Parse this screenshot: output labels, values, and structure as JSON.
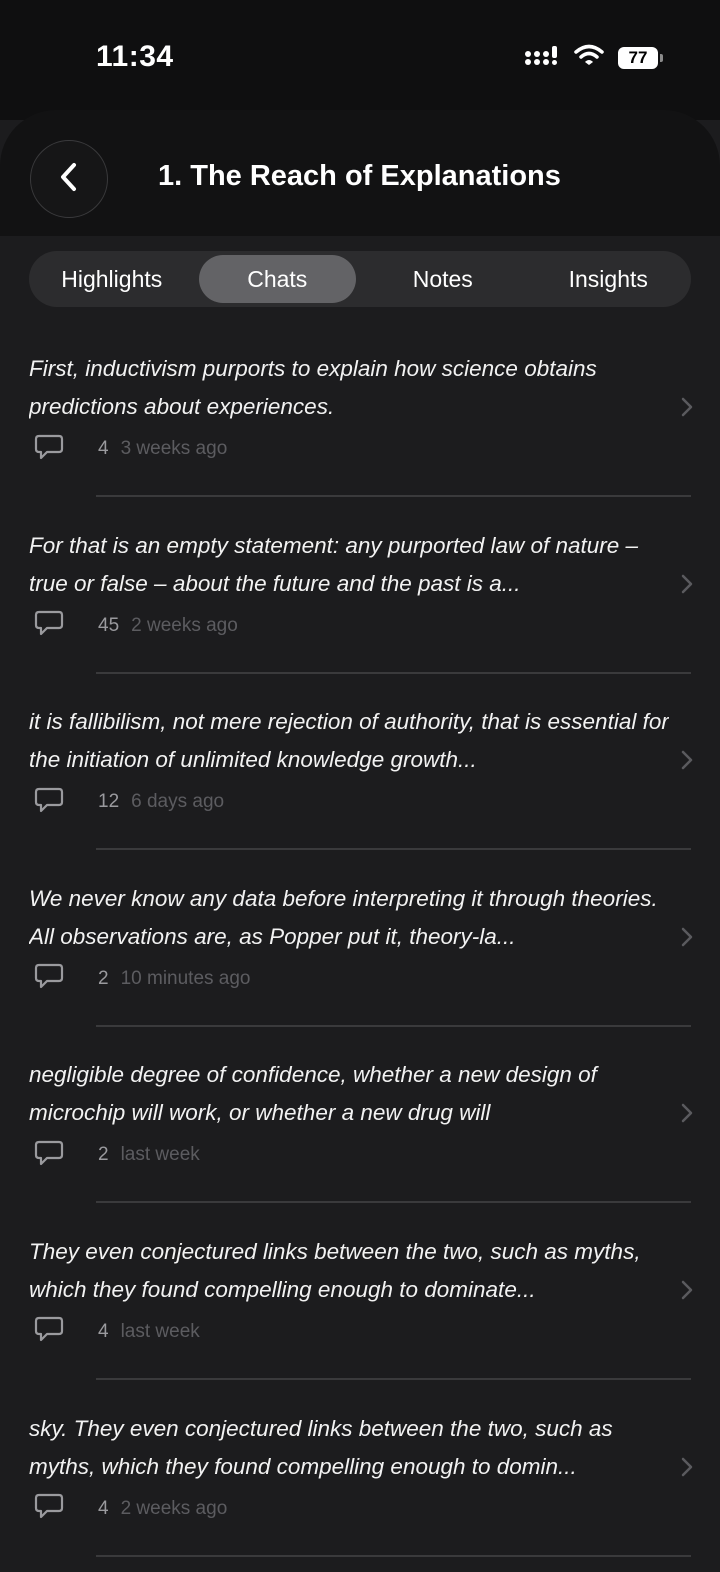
{
  "status_bar": {
    "time": "11:34",
    "battery": "77",
    "icons": [
      "signal-icon",
      "wifi-icon",
      "battery-icon"
    ]
  },
  "header": {
    "title": "1. The Reach of Explanations",
    "back_icon": "chevron-left-icon"
  },
  "tabs": [
    {
      "label": "Highlights",
      "active": false
    },
    {
      "label": "Chats",
      "active": true
    },
    {
      "label": "Notes",
      "active": false
    },
    {
      "label": "Insights",
      "active": false
    }
  ],
  "chats": [
    {
      "quote": "First, inductivism purports to explain how science obtains predictions about experiences.",
      "count": "4",
      "time": "3 weeks ago"
    },
    {
      "quote": "For that is an empty statement: any purported law of nature – true or false – about the future and the past is a...",
      "count": "45",
      "time": "2 weeks ago"
    },
    {
      "quote": "it is fallibilism, not mere rejection of authority, that is essential for the initiation of unlimited knowledge growth...",
      "count": "12",
      "time": "6 days ago"
    },
    {
      "quote": "We never know any data before interpreting it through theories. All observations are, as Popper put it, theory-la...",
      "count": "2",
      "time": "10 minutes ago"
    },
    {
      "quote": "negligible degree of confidence, whether a new design of microchip will work, or whether a new drug will",
      "count": "2",
      "time": "last week"
    },
    {
      "quote": "They even conjectured links between the two, such as myths, which they found compelling enough to dominate...",
      "count": "4",
      "time": "last week"
    },
    {
      "quote": "sky. They even conjectured links between the two, such as myths, which they found compelling enough to domin...",
      "count": "4",
      "time": "2 weeks ago"
    }
  ],
  "colors": {
    "background": "#1c1c1e",
    "header": "#121213",
    "tab_active": "#636366",
    "tab_bar": "#2c2c2e"
  }
}
